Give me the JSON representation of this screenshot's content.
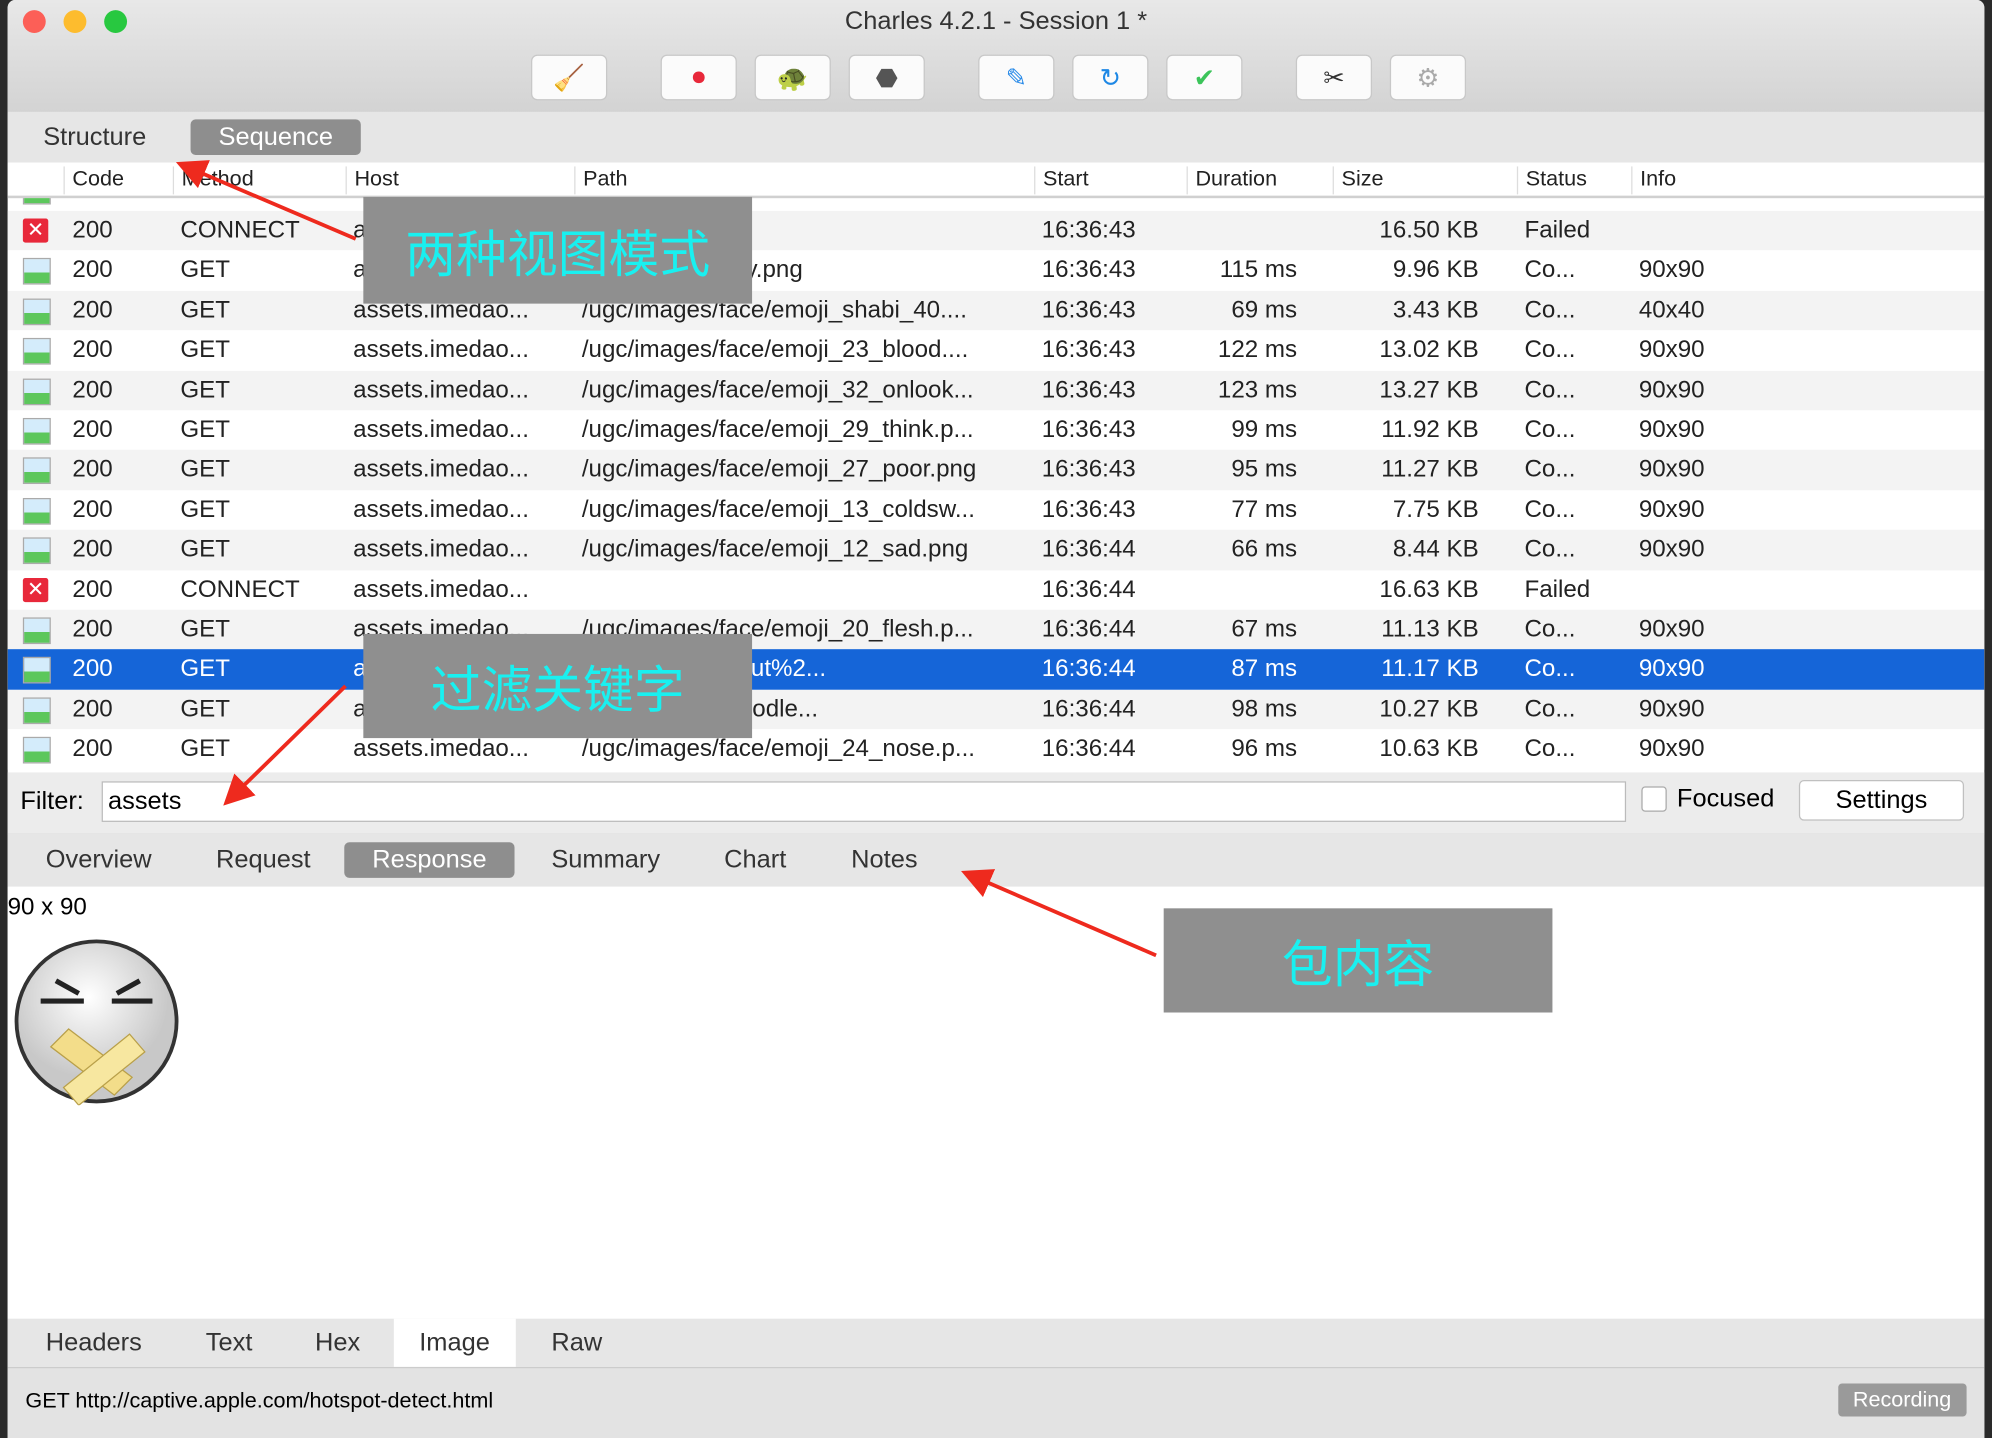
{
  "window": {
    "title": "Charles 4.2.1 - Session 1 *"
  },
  "toolbar": {
    "buttons": [
      {
        "name": "broom-icon",
        "glyph": "🧹"
      },
      {
        "name": "record-icon",
        "glyph": "⏺"
      },
      {
        "name": "turtle-icon",
        "glyph": "🐢"
      },
      {
        "name": "stop-icon",
        "glyph": "⬣"
      },
      {
        "name": "pen-icon",
        "glyph": "✎"
      },
      {
        "name": "refresh-icon",
        "glyph": "↻"
      },
      {
        "name": "check-icon",
        "glyph": "✔"
      },
      {
        "name": "tools-icon",
        "glyph": "✂"
      },
      {
        "name": "gear-icon",
        "glyph": "⚙"
      }
    ]
  },
  "view_tabs": {
    "structure": "Structure",
    "sequence": "Sequence",
    "active": "Sequence"
  },
  "columns": [
    "Code",
    "Method",
    "Host",
    "Path",
    "Start",
    "Duration",
    "Size",
    "Status",
    "Info"
  ],
  "rows": [
    {
      "icon": "error",
      "code": "200",
      "method": "CONNECT",
      "host": "a",
      "path": "",
      "start": "16:36:43",
      "duration": "",
      "size": "16.50 KB",
      "status": "Failed",
      "info": ""
    },
    {
      "icon": "image",
      "code": "200",
      "method": "GET",
      "host": "a",
      "path": "ce/emoji_09_cry.png",
      "start": "16:36:43",
      "duration": "115 ms",
      "size": "9.96 KB",
      "status": "Co...",
      "info": "90x90"
    },
    {
      "icon": "image",
      "code": "200",
      "method": "GET",
      "host": "assets.imedao...",
      "path": "/ugc/images/face/emoji_shabi_40....",
      "start": "16:36:43",
      "duration": "69 ms",
      "size": "3.43 KB",
      "status": "Co...",
      "info": "40x40"
    },
    {
      "icon": "image",
      "code": "200",
      "method": "GET",
      "host": "assets.imedao...",
      "path": "/ugc/images/face/emoji_23_blood....",
      "start": "16:36:43",
      "duration": "122 ms",
      "size": "13.02 KB",
      "status": "Co...",
      "info": "90x90"
    },
    {
      "icon": "image",
      "code": "200",
      "method": "GET",
      "host": "assets.imedao...",
      "path": "/ugc/images/face/emoji_32_onlook...",
      "start": "16:36:43",
      "duration": "123 ms",
      "size": "13.27 KB",
      "status": "Co...",
      "info": "90x90"
    },
    {
      "icon": "image",
      "code": "200",
      "method": "GET",
      "host": "assets.imedao...",
      "path": "/ugc/images/face/emoji_29_think.p...",
      "start": "16:36:43",
      "duration": "99 ms",
      "size": "11.92 KB",
      "status": "Co...",
      "info": "90x90"
    },
    {
      "icon": "image",
      "code": "200",
      "method": "GET",
      "host": "assets.imedao...",
      "path": "/ugc/images/face/emoji_27_poor.png",
      "start": "16:36:43",
      "duration": "95 ms",
      "size": "11.27 KB",
      "status": "Co...",
      "info": "90x90"
    },
    {
      "icon": "image",
      "code": "200",
      "method": "GET",
      "host": "assets.imedao...",
      "path": "/ugc/images/face/emoji_13_coldsw...",
      "start": "16:36:43",
      "duration": "77 ms",
      "size": "7.75 KB",
      "status": "Co...",
      "info": "90x90"
    },
    {
      "icon": "image",
      "code": "200",
      "method": "GET",
      "host": "assets.imedao...",
      "path": "/ugc/images/face/emoji_12_sad.png",
      "start": "16:36:44",
      "duration": "66 ms",
      "size": "8.44 KB",
      "status": "Co...",
      "info": "90x90"
    },
    {
      "icon": "error",
      "code": "200",
      "method": "CONNECT",
      "host": "assets.imedao...",
      "path": "",
      "start": "16:36:44",
      "duration": "",
      "size": "16.63 KB",
      "status": "Failed",
      "info": ""
    },
    {
      "icon": "image",
      "code": "200",
      "method": "GET",
      "host": "assets.imedao...",
      "path": "/ugc/images/face/emoji_20_flesh.p...",
      "start": "16:36:44",
      "duration": "67 ms",
      "size": "11.13 KB",
      "status": "Co...",
      "info": "90x90"
    },
    {
      "icon": "image",
      "code": "200",
      "method": "GET",
      "host": "a",
      "path": "ce/emoji_31_shut%2...",
      "start": "16:36:44",
      "duration": "87 ms",
      "size": "11.17 KB",
      "status": "Co...",
      "info": "90x90",
      "selected": true
    },
    {
      "icon": "image",
      "code": "200",
      "method": "GET",
      "host": "a",
      "path": "ce/emoji_19_noodle...",
      "start": "16:36:44",
      "duration": "98 ms",
      "size": "10.27 KB",
      "status": "Co...",
      "info": "90x90"
    },
    {
      "icon": "image",
      "code": "200",
      "method": "GET",
      "host": "assets.imedao...",
      "path": "/ugc/images/face/emoji_24_nose.p...",
      "start": "16:36:44",
      "duration": "96 ms",
      "size": "10.63 KB",
      "status": "Co...",
      "info": "90x90"
    }
  ],
  "filter": {
    "label": "Filter:",
    "value": "assets",
    "focused_label": "Focused",
    "focused_checked": false,
    "settings_label": "Settings"
  },
  "detail_tabs": [
    "Overview",
    "Request",
    "Response",
    "Summary",
    "Chart",
    "Notes"
  ],
  "detail_active": "Response",
  "content": {
    "dimensions": "90 x 90"
  },
  "bottom_tabs": [
    "Headers",
    "Text",
    "Hex",
    "Image",
    "Raw"
  ],
  "bottom_active": "Image",
  "statusbar": {
    "text": "GET http://captive.apple.com/hotspot-detect.html",
    "recording": "Recording"
  },
  "annotations": {
    "view_modes": "两种视图模式",
    "filter_keyword": "过滤关键字",
    "packet_content": "包内容"
  },
  "colors": {
    "selection": "#1565d8",
    "annotation_text": "#19f0f0",
    "annotation_bg": "#8f8f8f",
    "arrow": "#ee2a1e"
  }
}
